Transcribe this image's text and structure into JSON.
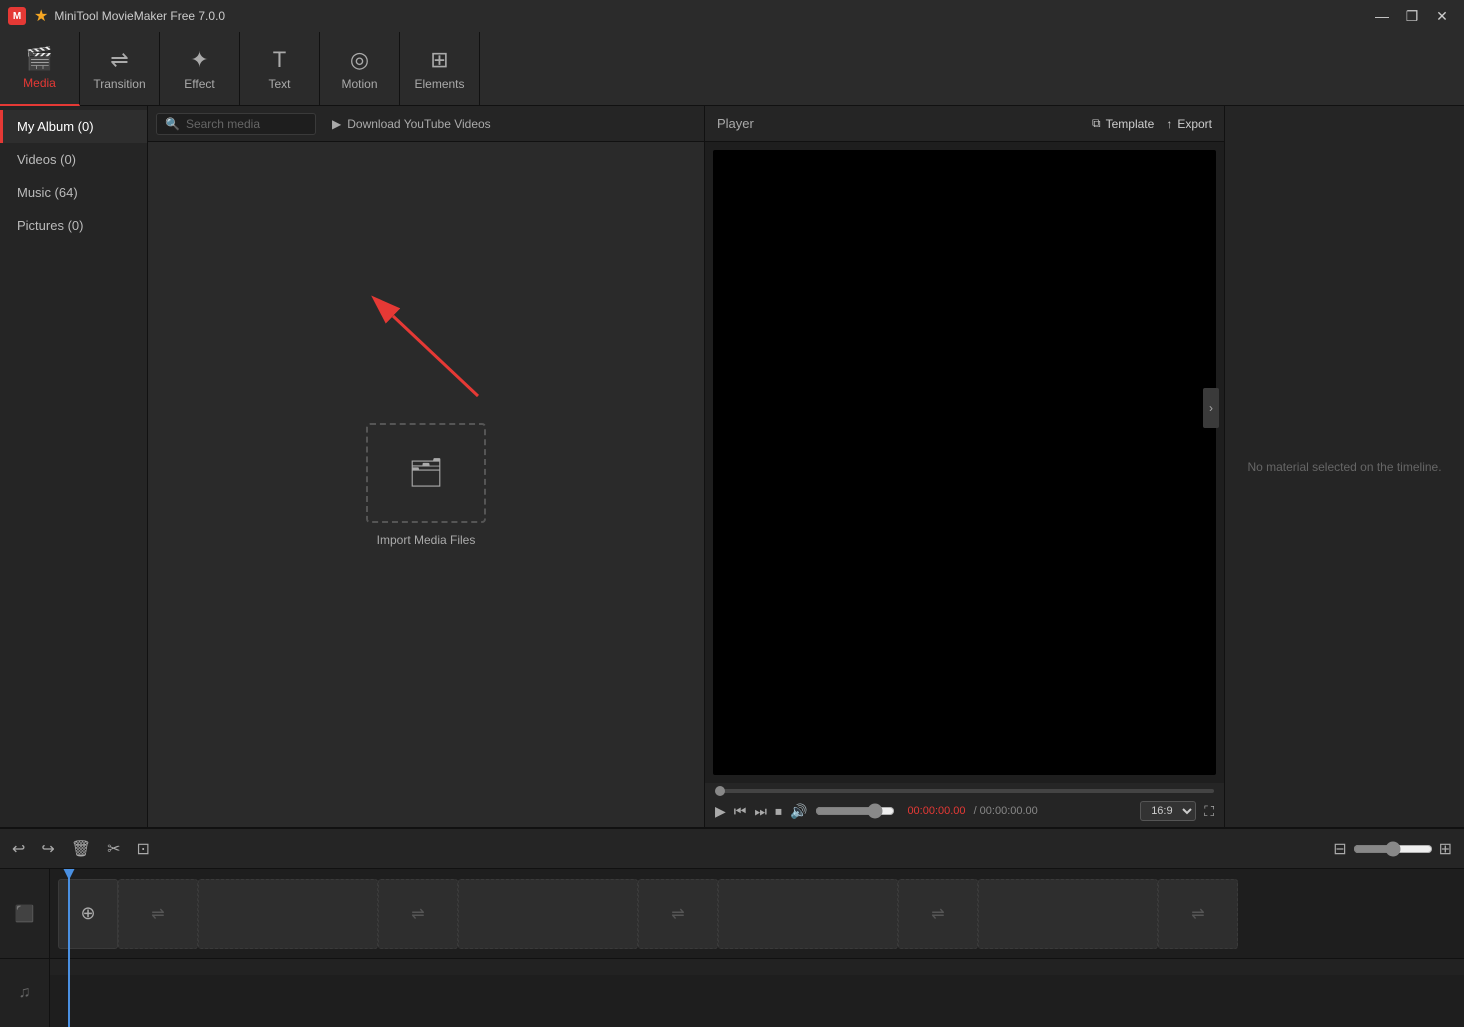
{
  "app": {
    "title": "MiniTool MovieMaker Free 7.0.0",
    "icon_label": "M"
  },
  "titlebar": {
    "icon_color": "#f5a623",
    "win_btns": [
      "—",
      "❐",
      "✕"
    ]
  },
  "toolbar": {
    "items": [
      {
        "id": "media",
        "label": "Media",
        "icon": "🎬",
        "active": true
      },
      {
        "id": "transition",
        "label": "Transition",
        "icon": "⇌"
      },
      {
        "id": "effect",
        "label": "Effect",
        "icon": "✦"
      },
      {
        "id": "text",
        "label": "Text",
        "icon": "T"
      },
      {
        "id": "motion",
        "label": "Motion",
        "icon": "◎"
      },
      {
        "id": "elements",
        "label": "Elements",
        "icon": "⊞"
      }
    ]
  },
  "sidebar": {
    "items": [
      {
        "id": "my-album",
        "label": "My Album (0)",
        "active": true
      },
      {
        "id": "videos",
        "label": "Videos (0)"
      },
      {
        "id": "music",
        "label": "Music (64)"
      },
      {
        "id": "pictures",
        "label": "Pictures (0)"
      }
    ]
  },
  "media_panel": {
    "search_placeholder": "Search media",
    "yt_download_label": "Download YouTube Videos",
    "import_label": "Import Media Files"
  },
  "player": {
    "label": "Player",
    "template_label": "Template",
    "export_label": "Export",
    "current_time": "00:00:00.00",
    "total_time": "/ 00:00:00.00",
    "aspect_ratio": "16:9",
    "no_material": "No material selected on the timeline."
  },
  "timeline": {
    "undo_icon": "↩",
    "redo_icon": "↪",
    "delete_icon": "🗑",
    "cut_icon": "✂",
    "crop_icon": "⊡",
    "add_track_icon": "⊕",
    "transition_icon": "⇌",
    "zoom_in_icon": "+",
    "zoom_out_icon": "−",
    "video_track_icon": "⬛",
    "audio_track_icon": "♫"
  }
}
